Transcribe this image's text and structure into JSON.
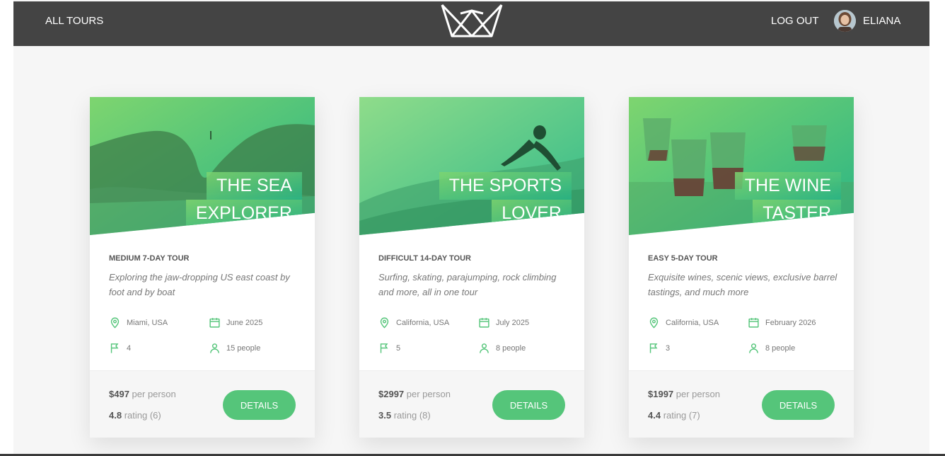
{
  "nav": {
    "all_tours": "ALL TOURS",
    "logout": "LOG OUT",
    "user_name": "ELIANA"
  },
  "colors": {
    "accent": "#55c57a",
    "topbar": "#444444"
  },
  "tours": [
    {
      "title_line1": "THE SEA",
      "title_line2": "EXPLORER",
      "subtitle": "MEDIUM 7-DAY TOUR",
      "description": "Exploring the jaw-dropping US east coast by foot and by boat",
      "location": "Miami, USA",
      "date": "June 2025",
      "stops": "4",
      "people": "15 people",
      "price": "$497",
      "price_unit": "per person",
      "rating_value": "4.8",
      "rating_label": "rating (6)",
      "button": "DETAILS"
    },
    {
      "title_line1": "THE SPORTS",
      "title_line2": "LOVER",
      "subtitle": "DIFFICULT 14-DAY TOUR",
      "description": "Surfing, skating, parajumping, rock climbing and more, all in one tour",
      "location": "California, USA",
      "date": "July 2025",
      "stops": "5",
      "people": "8 people",
      "price": "$2997",
      "price_unit": "per person",
      "rating_value": "3.5",
      "rating_label": "rating (8)",
      "button": "DETAILS"
    },
    {
      "title_line1": "THE WINE",
      "title_line2": "TASTER",
      "subtitle": "EASY 5-DAY TOUR",
      "description": "Exquisite wines, scenic views, exclusive barrel tastings, and much more",
      "location": "California, USA",
      "date": "February 2026",
      "stops": "3",
      "people": "8 people",
      "price": "$1997",
      "price_unit": "per person",
      "rating_value": "4.4",
      "rating_label": "rating (7)",
      "button": "DETAILS"
    }
  ]
}
